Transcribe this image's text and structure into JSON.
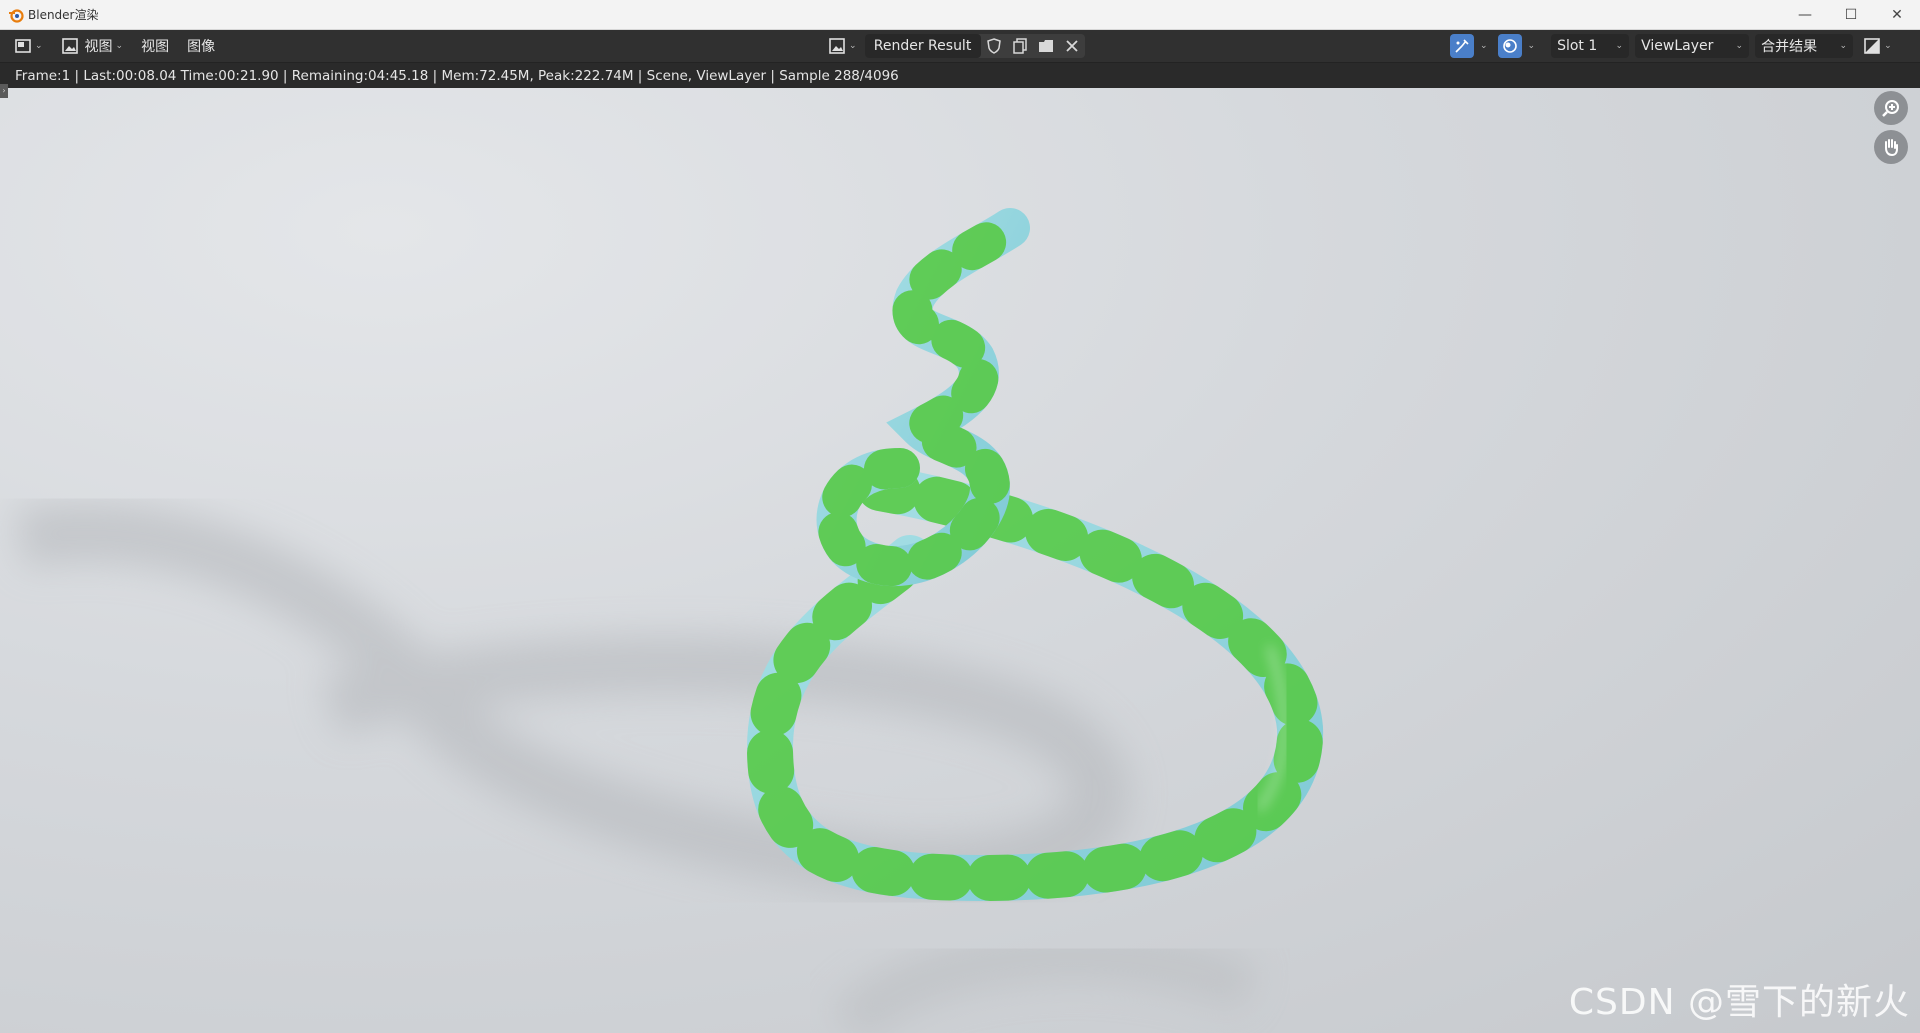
{
  "window": {
    "title": "Blender渲染",
    "controls": {
      "minimize": "—",
      "maximize": "☐",
      "close": "✕"
    }
  },
  "header": {
    "view_menu_1": "视图",
    "view_menu_2": "视图",
    "image_menu": "图像",
    "image_name": "Render Result",
    "slot": "Slot 1",
    "view_layer": "ViewLayer",
    "pass": "合并结果"
  },
  "info": {
    "text": "Frame:1 | Last:00:08.04 Time:00:21.90 | Remaining:04:45.18 | Mem:72.45M, Peak:222.74M | Scene, ViewLayer | Sample 288/4096"
  },
  "colors": {
    "accent_blue": "#4a7fc9",
    "tube_cyan": "#8fd3dc",
    "tube_green": "#55c93e"
  },
  "icons": {
    "editor_type": "image-editor-icon",
    "image": "image-icon",
    "fake_user": "shield-icon",
    "new_image": "duplicate-icon",
    "open_image": "folder-icon",
    "unlink": "close-icon",
    "sample_tool": "sample-tool-icon",
    "render_slot": "render-icon",
    "display_channels": "display-channels-icon",
    "zoom": "zoom-icon",
    "pan": "hand-icon"
  },
  "watermark": "CSDN @雪下的新火"
}
